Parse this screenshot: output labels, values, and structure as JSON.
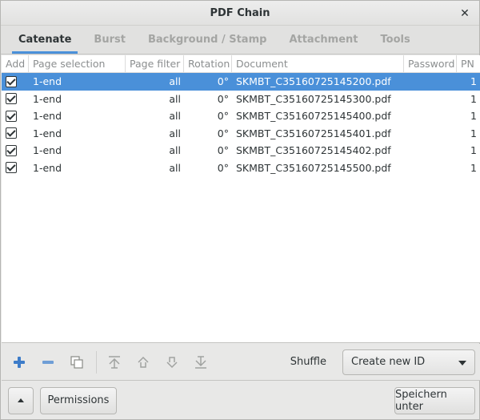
{
  "window": {
    "title": "PDF Chain"
  },
  "tabs": [
    {
      "label": "Catenate",
      "active": true
    },
    {
      "label": "Burst",
      "active": false
    },
    {
      "label": "Background / Stamp",
      "active": false
    },
    {
      "label": "Attachment",
      "active": false
    },
    {
      "label": "Tools",
      "active": false
    }
  ],
  "table": {
    "columns": [
      "Add",
      "Page selection",
      "Page filter",
      "Rotation",
      "Document",
      "Password",
      "PN"
    ],
    "rows": [
      {
        "add": true,
        "page_selection": "1-end",
        "page_filter": "all",
        "rotation": "0°",
        "document": "SKMBT_C35160725145200.pdf",
        "password": "",
        "pn": "1",
        "selected": true
      },
      {
        "add": true,
        "page_selection": "1-end",
        "page_filter": "all",
        "rotation": "0°",
        "document": "SKMBT_C35160725145300.pdf",
        "password": "",
        "pn": "1",
        "selected": false
      },
      {
        "add": true,
        "page_selection": "1-end",
        "page_filter": "all",
        "rotation": "0°",
        "document": "SKMBT_C35160725145400.pdf",
        "password": "",
        "pn": "1",
        "selected": false
      },
      {
        "add": true,
        "page_selection": "1-end",
        "page_filter": "all",
        "rotation": "0°",
        "document": "SKMBT_C35160725145401.pdf",
        "password": "",
        "pn": "1",
        "selected": false
      },
      {
        "add": true,
        "page_selection": "1-end",
        "page_filter": "all",
        "rotation": "0°",
        "document": "SKMBT_C35160725145402.pdf",
        "password": "",
        "pn": "1",
        "selected": false
      },
      {
        "add": true,
        "page_selection": "1-end",
        "page_filter": "all",
        "rotation": "0°",
        "document": "SKMBT_C35160725145500.pdf",
        "password": "",
        "pn": "1",
        "selected": false
      }
    ]
  },
  "toolbar": {
    "icons": [
      "add-icon",
      "remove-icon",
      "copy-icon",
      "move-top-icon",
      "move-up-icon",
      "move-down-icon",
      "move-bottom-icon"
    ],
    "shuffle_label": "Shuffle",
    "combo_value": "Create new ID"
  },
  "bottom": {
    "permissions_label": "Permissions",
    "save_label": "Speichern unter"
  },
  "colors": {
    "accent": "#4a90d9",
    "add_icon": "#3d7cc9"
  }
}
